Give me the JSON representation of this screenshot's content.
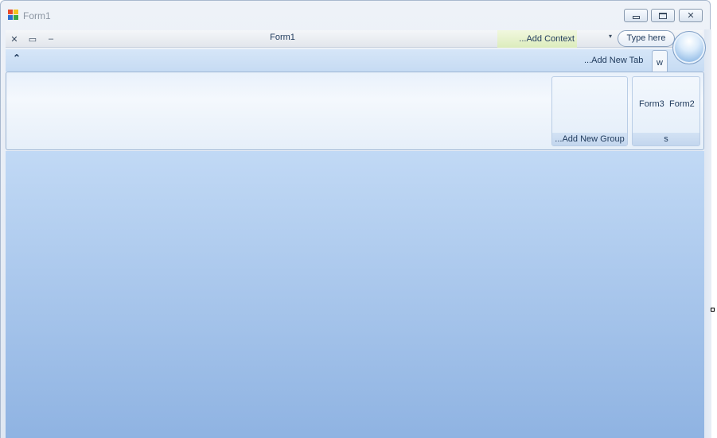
{
  "window": {
    "title": "Form1",
    "icon": "form-app-icon"
  },
  "caption_buttons": {
    "minimize_icon": "minimize-icon",
    "maximize_icon": "maximize-icon",
    "close_label": "✕"
  },
  "quick_access": {
    "close_glyph": "✕",
    "restore_glyph": "▭",
    "minimize_glyph": "–",
    "form_title": "Form1",
    "add_context": "...Add Context",
    "dropdown_glyph": "▾",
    "type_here": "Type here"
  },
  "tabs": {
    "collapse_glyph": "⌃",
    "add_new_tab": "...Add New Tab",
    "active_tab": "w"
  },
  "ribbon": {
    "add_new_group": "...Add New Group",
    "group_s_caption": "s",
    "buttons": [
      "Form3",
      "Form2"
    ]
  },
  "colors": {
    "text": "#1e395b",
    "client_top": "#c1d9f5",
    "client_bottom": "#8fb3e2",
    "context_tab": "#dcecbc"
  }
}
